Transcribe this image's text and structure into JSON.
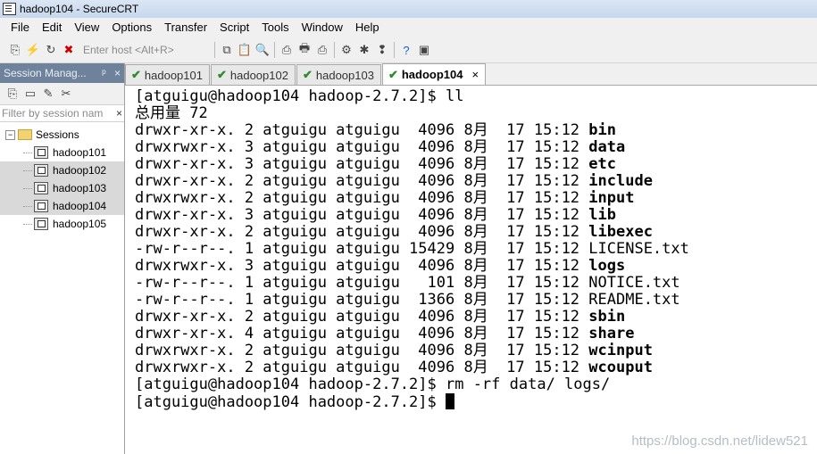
{
  "window": {
    "title": "hadoop104 - SecureCRT"
  },
  "menu": {
    "items": [
      "File",
      "Edit",
      "View",
      "Options",
      "Transfer",
      "Script",
      "Tools",
      "Window",
      "Help"
    ]
  },
  "toolbar": {
    "host_placeholder": "Enter host <Alt+R>"
  },
  "sidebar": {
    "title": "Session Manag...",
    "pin": "ᵖ",
    "close": "×",
    "filter_placeholder": "Filter by session nam",
    "filter_clear": "×",
    "root": {
      "expander": "−",
      "label": "Sessions"
    },
    "sessions": [
      "hadoop101",
      "hadoop102",
      "hadoop103",
      "hadoop104",
      "hadoop105"
    ]
  },
  "tabs": [
    {
      "label": "hadoop101",
      "active": false
    },
    {
      "label": "hadoop102",
      "active": false
    },
    {
      "label": "hadoop103",
      "active": false
    },
    {
      "label": "hadoop104",
      "active": true
    }
  ],
  "tab_close": "×",
  "terminal": {
    "lines": [
      {
        "text": "[atguigu@hadoop104 hadoop-2.7.2]$ ll"
      },
      {
        "text": "总用量 72"
      },
      {
        "text": "drwxr-xr-x. 2 atguigu atguigu  4096 8月  17 15:12 ",
        "name": "bin",
        "bold": true
      },
      {
        "text": "drwxrwxr-x. 3 atguigu atguigu  4096 8月  17 15:12 ",
        "name": "data",
        "bold": true
      },
      {
        "text": "drwxr-xr-x. 3 atguigu atguigu  4096 8月  17 15:12 ",
        "name": "etc",
        "bold": true
      },
      {
        "text": "drwxr-xr-x. 2 atguigu atguigu  4096 8月  17 15:12 ",
        "name": "include",
        "bold": true
      },
      {
        "text": "drwxrwxr-x. 2 atguigu atguigu  4096 8月  17 15:12 ",
        "name": "input",
        "bold": true
      },
      {
        "text": "drwxr-xr-x. 3 atguigu atguigu  4096 8月  17 15:12 ",
        "name": "lib",
        "bold": true
      },
      {
        "text": "drwxr-xr-x. 2 atguigu atguigu  4096 8月  17 15:12 ",
        "name": "libexec",
        "bold": true
      },
      {
        "text": "-rw-r--r--. 1 atguigu atguigu 15429 8月  17 15:12 ",
        "name": "LICENSE.txt",
        "bold": false
      },
      {
        "text": "drwxrwxr-x. 3 atguigu atguigu  4096 8月  17 15:12 ",
        "name": "logs",
        "bold": true
      },
      {
        "text": "-rw-r--r--. 1 atguigu atguigu   101 8月  17 15:12 ",
        "name": "NOTICE.txt",
        "bold": false
      },
      {
        "text": "-rw-r--r--. 1 atguigu atguigu  1366 8月  17 15:12 ",
        "name": "README.txt",
        "bold": false
      },
      {
        "text": "drwxr-xr-x. 2 atguigu atguigu  4096 8月  17 15:12 ",
        "name": "sbin",
        "bold": true
      },
      {
        "text": "drwxr-xr-x. 4 atguigu atguigu  4096 8月  17 15:12 ",
        "name": "share",
        "bold": true
      },
      {
        "text": "drwxrwxr-x. 2 atguigu atguigu  4096 8月  17 15:12 ",
        "name": "wcinput",
        "bold": true
      },
      {
        "text": "drwxrwxr-x. 2 atguigu atguigu  4096 8月  17 15:12 ",
        "name": "wcouput",
        "bold": true
      },
      {
        "text": "[atguigu@hadoop104 hadoop-2.7.2]$ rm -rf data/ logs/"
      },
      {
        "text": "[atguigu@hadoop104 hadoop-2.7.2]$ ",
        "cursor": true
      }
    ]
  },
  "watermark": "https://blog.csdn.net/lidew521"
}
